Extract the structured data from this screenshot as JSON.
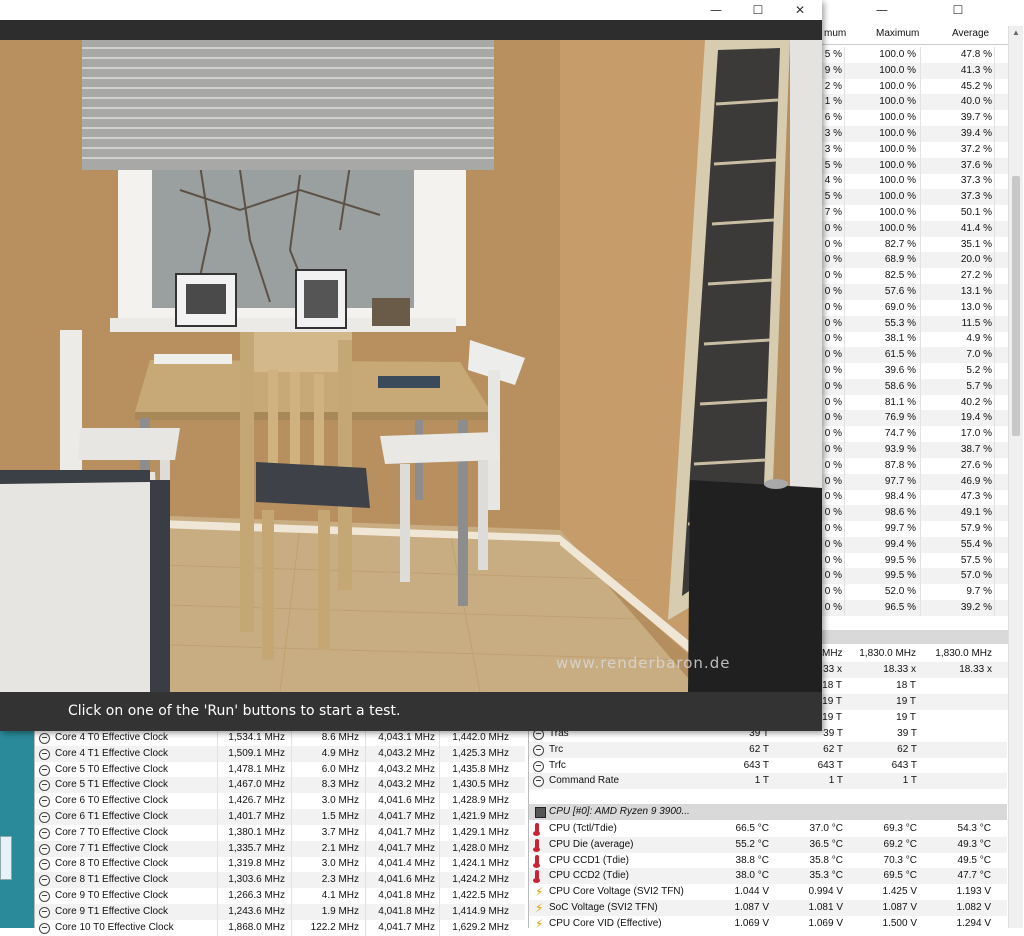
{
  "hwinfo": {
    "columns": {
      "minimum_partial": "mum",
      "maximum": "Maximum",
      "average": "Average"
    },
    "cpu_usage_rows": [
      [
        "5 %",
        "100.0 %",
        "47.8 %"
      ],
      [
        "9 %",
        "100.0 %",
        "41.3 %"
      ],
      [
        "2 %",
        "100.0 %",
        "45.2 %"
      ],
      [
        "1 %",
        "100.0 %",
        "40.0 %"
      ],
      [
        "6 %",
        "100.0 %",
        "39.7 %"
      ],
      [
        "3 %",
        "100.0 %",
        "39.4 %"
      ],
      [
        "3 %",
        "100.0 %",
        "37.2 %"
      ],
      [
        "5 %",
        "100.0 %",
        "37.6 %"
      ],
      [
        "4 %",
        "100.0 %",
        "37.3 %"
      ],
      [
        "5 %",
        "100.0 %",
        "37.3 %"
      ],
      [
        "7 %",
        "100.0 %",
        "50.1 %"
      ],
      [
        "0 %",
        "100.0 %",
        "41.4 %"
      ],
      [
        "0 %",
        "82.7 %",
        "35.1 %"
      ],
      [
        "0 %",
        "68.9 %",
        "20.0 %"
      ],
      [
        "0 %",
        "82.5 %",
        "27.2 %"
      ],
      [
        "0 %",
        "57.6 %",
        "13.1 %"
      ],
      [
        "0 %",
        "69.0 %",
        "13.0 %"
      ],
      [
        "0 %",
        "55.3 %",
        "11.5 %"
      ],
      [
        "0 %",
        "38.1 %",
        "4.9 %"
      ],
      [
        "0 %",
        "61.5 %",
        "7.0 %"
      ],
      [
        "0 %",
        "39.6 %",
        "5.2 %"
      ],
      [
        "0 %",
        "58.6 %",
        "5.7 %"
      ],
      [
        "0 %",
        "81.1 %",
        "40.2 %"
      ],
      [
        "0 %",
        "76.9 %",
        "19.4 %"
      ],
      [
        "0 %",
        "74.7 %",
        "17.0 %"
      ],
      [
        "0 %",
        "93.9 %",
        "38.7 %"
      ],
      [
        "0 %",
        "87.8 %",
        "27.6 %"
      ],
      [
        "0 %",
        "97.7 %",
        "46.9 %"
      ],
      [
        "0 %",
        "98.4 %",
        "47.3 %"
      ],
      [
        "0 %",
        "98.6 %",
        "49.1 %"
      ],
      [
        "0 %",
        "99.7 %",
        "57.9 %"
      ],
      [
        "0 %",
        "99.4 %",
        "55.4 %"
      ],
      [
        "0 %",
        "99.5 %",
        "57.5 %"
      ],
      [
        "0 %",
        "99.5 %",
        "57.0 %"
      ],
      [
        "0 %",
        "52.0 %",
        "9.7 %"
      ],
      [
        "0 %",
        "96.5 %",
        "39.2 %"
      ]
    ],
    "clock_rows": [
      [
        "MHz",
        "1,830.0 MHz",
        "1,830.0 MHz"
      ],
      [
        "33 x",
        "18.33 x",
        "18.33 x"
      ],
      [
        "18 T",
        "18 T",
        ""
      ],
      [
        "19 T",
        "19 T",
        ""
      ],
      [
        "19 T",
        "19 T",
        ""
      ]
    ],
    "effective_clocks": [
      [
        "Core 4 T0 Effective Clock",
        "1,534.1 MHz",
        "8.6 MHz",
        "4,043.1 MHz",
        "1,442.0 MHz"
      ],
      [
        "Core 4 T1 Effective Clock",
        "1,509.1 MHz",
        "4.9 MHz",
        "4,043.2 MHz",
        "1,425.3 MHz"
      ],
      [
        "Core 5 T0 Effective Clock",
        "1,478.1 MHz",
        "6.0 MHz",
        "4,043.2 MHz",
        "1,435.8 MHz"
      ],
      [
        "Core 5 T1 Effective Clock",
        "1,467.0 MHz",
        "8.3 MHz",
        "4,043.2 MHz",
        "1,430.5 MHz"
      ],
      [
        "Core 6 T0 Effective Clock",
        "1,426.7 MHz",
        "3.0 MHz",
        "4,041.6 MHz",
        "1,428.9 MHz"
      ],
      [
        "Core 6 T1 Effective Clock",
        "1,401.7 MHz",
        "1.5 MHz",
        "4,041.7 MHz",
        "1,421.9 MHz"
      ],
      [
        "Core 7 T0 Effective Clock",
        "1,380.1 MHz",
        "3.7 MHz",
        "4,041.7 MHz",
        "1,429.1 MHz"
      ],
      [
        "Core 7 T1 Effective Clock",
        "1,335.7 MHz",
        "2.1 MHz",
        "4,041.7 MHz",
        "1,428.0 MHz"
      ],
      [
        "Core 8 T0 Effective Clock",
        "1,319.8 MHz",
        "3.0 MHz",
        "4,041.4 MHz",
        "1,424.1 MHz"
      ],
      [
        "Core 8 T1 Effective Clock",
        "1,303.6 MHz",
        "2.3 MHz",
        "4,041.6 MHz",
        "1,424.2 MHz"
      ],
      [
        "Core 9 T0 Effective Clock",
        "1,266.3 MHz",
        "4.1 MHz",
        "4,041.8 MHz",
        "1,422.5 MHz"
      ],
      [
        "Core 9 T1 Effective Clock",
        "1,243.6 MHz",
        "1.9 MHz",
        "4,041.8 MHz",
        "1,414.9 MHz"
      ],
      [
        "Core 10 T0 Effective Clock",
        "1,868.0 MHz",
        "122.2 MHz",
        "4,041.7 MHz",
        "1,629.2 MHz"
      ]
    ],
    "memory_timings": [
      [
        "Tras",
        "39 T",
        "39 T",
        "39 T",
        ""
      ],
      [
        "Trc",
        "62 T",
        "62 T",
        "62 T",
        ""
      ],
      [
        "Trfc",
        "643 T",
        "643 T",
        "643 T",
        ""
      ],
      [
        "Command Rate",
        "1 T",
        "1 T",
        "1 T",
        ""
      ]
    ],
    "cpu_group_title": "CPU [#0]: AMD Ryzen 9 3900...",
    "cpu_sensors": [
      {
        "icon": "thermometer-icon",
        "name": "CPU (Tctl/Tdie)",
        "v": [
          "66.5 °C",
          "37.0 °C",
          "69.3 °C",
          "54.3 °C"
        ]
      },
      {
        "icon": "thermometer-icon",
        "name": "CPU Die (average)",
        "v": [
          "55.2 °C",
          "36.5 °C",
          "69.2 °C",
          "49.3 °C"
        ]
      },
      {
        "icon": "thermometer-icon",
        "name": "CPU CCD1 (Tdie)",
        "v": [
          "38.8 °C",
          "35.8 °C",
          "70.3 °C",
          "49.5 °C"
        ]
      },
      {
        "icon": "thermometer-icon",
        "name": "CPU CCD2 (Tdie)",
        "v": [
          "38.0 °C",
          "35.3 °C",
          "69.5 °C",
          "47.7 °C"
        ]
      },
      {
        "icon": "voltage-icon",
        "name": "CPU Core Voltage (SVI2 TFN)",
        "v": [
          "1.044 V",
          "0.994 V",
          "1.425 V",
          "1.193 V"
        ]
      },
      {
        "icon": "voltage-icon",
        "name": "SoC Voltage (SVI2 TFN)",
        "v": [
          "1.087 V",
          "1.081 V",
          "1.087 V",
          "1.082 V"
        ]
      },
      {
        "icon": "voltage-icon",
        "name": "CPU Core VID (Effective)",
        "v": [
          "1.069 V",
          "1.069 V",
          "1.500 V",
          "1.294 V"
        ]
      }
    ]
  },
  "cinebench": {
    "status_text": "Click on one of the 'Run' buttons to start a test.",
    "watermark": "www.renderbaron.de",
    "titlebar": {
      "minimize": "—",
      "maximize": "☐",
      "close": "✕"
    }
  },
  "colors": {
    "render_wall": "#b48e5e",
    "status_bar": "#333333",
    "taskbar_teal": "#2a8a9a"
  }
}
